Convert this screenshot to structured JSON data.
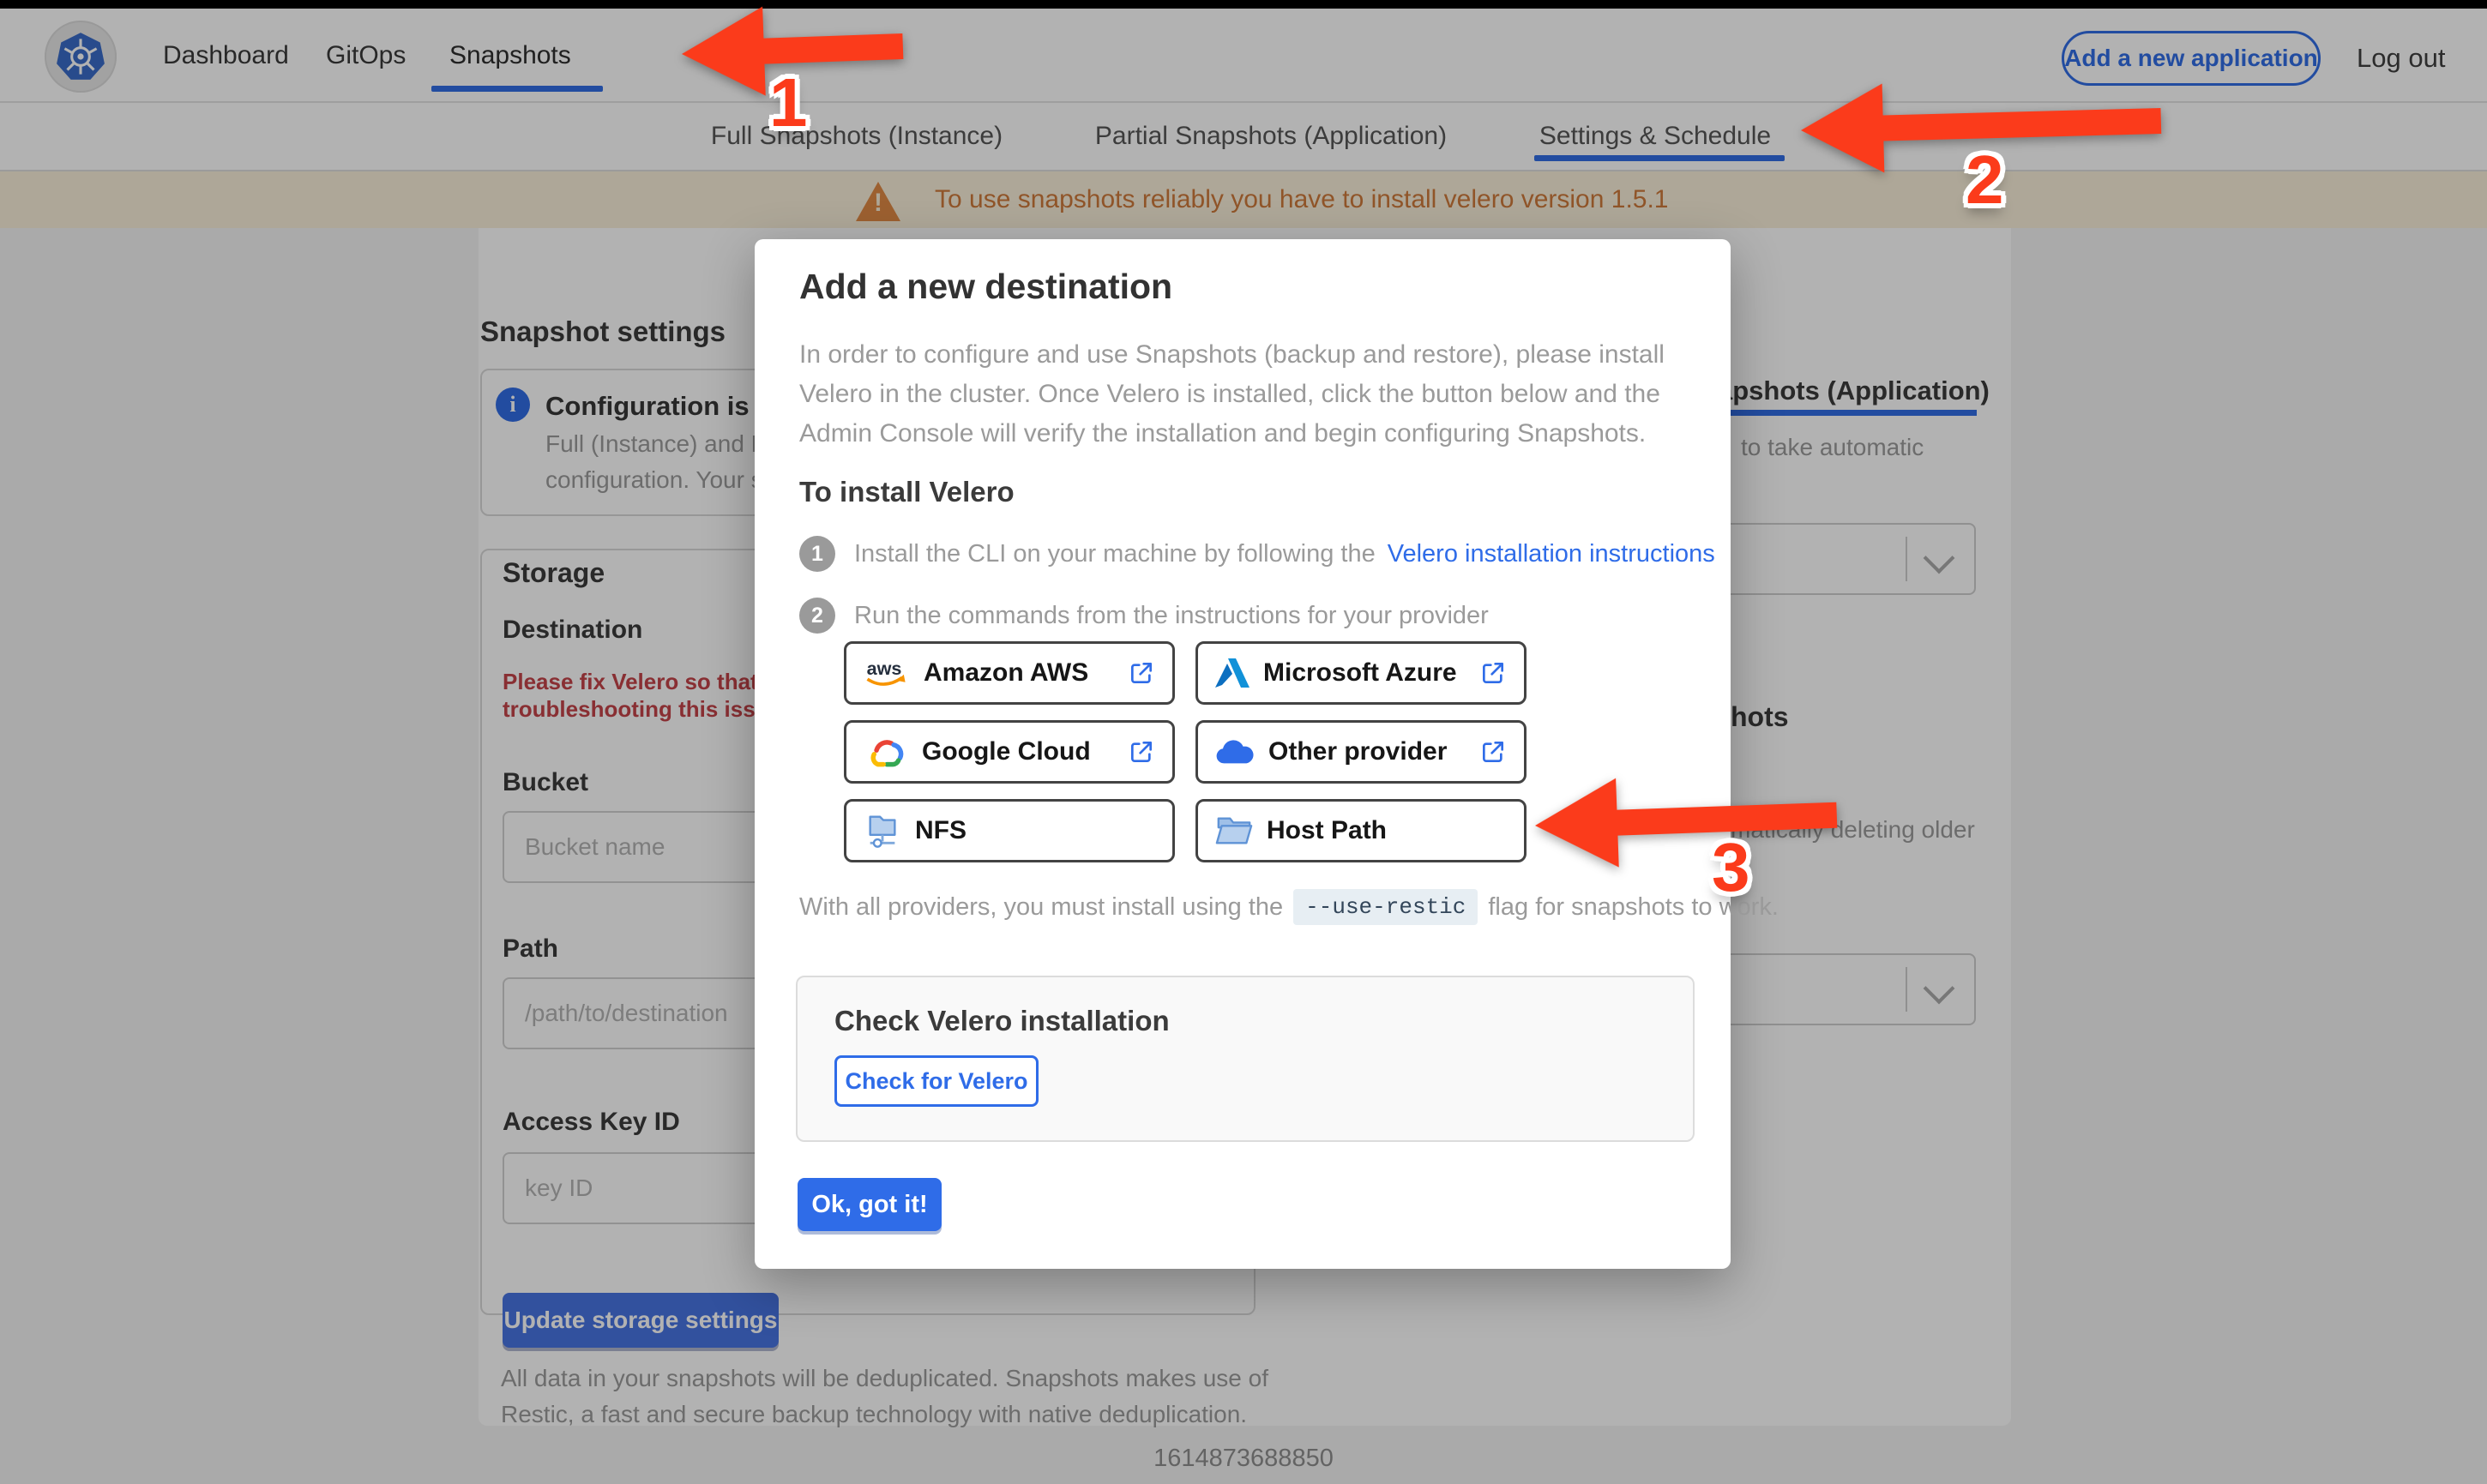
{
  "colors": {
    "accent": "#326de6",
    "link_blue": "#2f6ce8",
    "arrow_red": "#fb3b1b",
    "banner_bg": "#faf0da",
    "banner_text": "#cf7a3c",
    "error_red": "#c4444a",
    "update_button_bg": "#4874e2"
  },
  "header": {
    "logo_icon": "kubernetes-wheel-icon",
    "nav": [
      {
        "label": "Dashboard"
      },
      {
        "label": "GitOps"
      },
      {
        "label": "Snapshots",
        "active": true
      }
    ],
    "add_app_label": "Add a new application",
    "logout_label": "Log out"
  },
  "tabs": [
    {
      "label": "Full Snapshots (Instance)"
    },
    {
      "label": "Partial Snapshots (Application)"
    },
    {
      "label": "Settings & Schedule",
      "active": true
    }
  ],
  "banner": {
    "icon": "warning-triangle-icon",
    "text": "To use snapshots reliably you have to install velero version 1.5.1"
  },
  "settings_page": {
    "title": "Snapshot settings",
    "info_box": {
      "icon": "info-circle-icon",
      "title": "Configuration is sh",
      "line1": "Full (Instance) and Parti",
      "line2": "configuration. Your stor"
    },
    "storage": {
      "heading": "Storage",
      "destination_label": "Destination",
      "error_line1": "Please fix Velero so that th",
      "error_line2": "troubleshooting this issue",
      "bucket_label": "Bucket",
      "bucket_placeholder": "Bucket name",
      "path_label": "Path",
      "path_placeholder": "/path/to/destination",
      "access_key_label": "Access Key ID",
      "access_key_placeholder": "key ID",
      "update_button": "Update storage settings"
    },
    "dedup_line1": "All data in your snapshots will be deduplicated. Snapshots makes use of",
    "dedup_line2": "Restic, a fast and secure backup technology with native deduplication.",
    "schedule_fragment": {
      "tab": "Partial Snapshots (Application)",
      "auto_text": "to take automatic",
      "heading": "hots",
      "retention_text": "matically deleting older"
    }
  },
  "footer": {
    "timestamp": "1614873688850"
  },
  "modal": {
    "title": "Add a new destination",
    "body_line1": "In order to configure and use Snapshots (backup and restore), please install",
    "body_line2": "Velero in the cluster. Once Velero is installed, click the button below and the",
    "body_line3": "Admin Console will verify the installation and begin configuring Snapshots.",
    "install_heading": "To install Velero",
    "steps": [
      {
        "num": "1",
        "text": "Install the CLI on your machine by following the",
        "link": "Velero installation instructions"
      },
      {
        "num": "2",
        "text": "Run the commands from the instructions for your provider",
        "link": ""
      }
    ],
    "providers": [
      {
        "label": "Amazon AWS",
        "icon": "aws-icon",
        "external": true
      },
      {
        "label": "Microsoft Azure",
        "icon": "azure-icon",
        "external": true
      },
      {
        "label": "Google Cloud",
        "icon": "google-cloud-icon",
        "external": true
      },
      {
        "label": "Other provider",
        "icon": "cloud-icon",
        "external": true
      },
      {
        "label": "NFS",
        "icon": "nfs-folder-icon",
        "external": false
      },
      {
        "label": "Host Path",
        "icon": "folder-icon",
        "external": false
      }
    ],
    "restic_note_prefix": "With all providers, you must install using the",
    "restic_flag": "--use-restic",
    "restic_note_suffix": "flag for snapshots to work.",
    "check_section": {
      "heading": "Check Velero installation",
      "button": "Check for Velero"
    },
    "ok_button": "Ok, got it!"
  },
  "annotations": {
    "labels": [
      "1",
      "2",
      "3"
    ]
  }
}
